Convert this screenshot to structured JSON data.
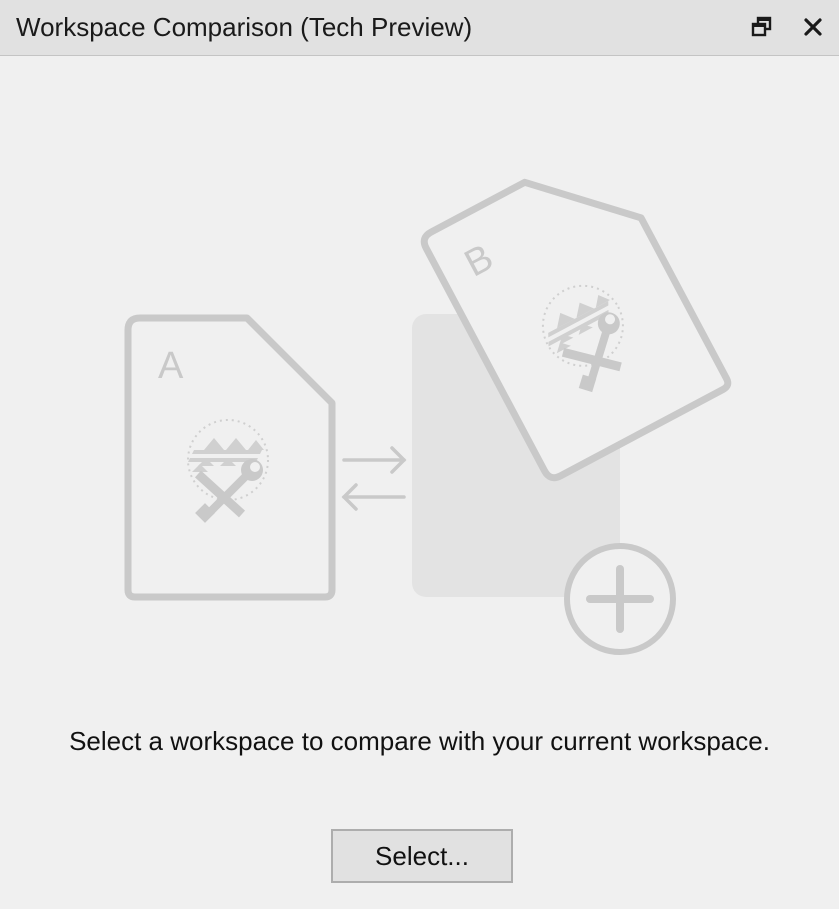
{
  "window": {
    "title": "Workspace Comparison (Tech Preview)"
  },
  "titlebar": {
    "float_icon": "float-window-icon",
    "close_icon": "close-icon"
  },
  "illustration": {
    "doc_a_label": "A",
    "doc_b_label": "B",
    "icons": [
      "document-a-icon",
      "document-b-icon",
      "compare-arrows-icon",
      "add-circle-icon"
    ]
  },
  "main": {
    "message": "Select a workspace to compare with your current workspace.",
    "select_button_label": "Select..."
  },
  "colors": {
    "titlebar_bg": "#e1e1e1",
    "panel_bg": "#f0f0f0",
    "illustration_stroke": "#c9c9c9",
    "placeholder_fill": "#e3e3e3",
    "button_bg": "#e1e1e1",
    "button_border": "#adadad"
  }
}
